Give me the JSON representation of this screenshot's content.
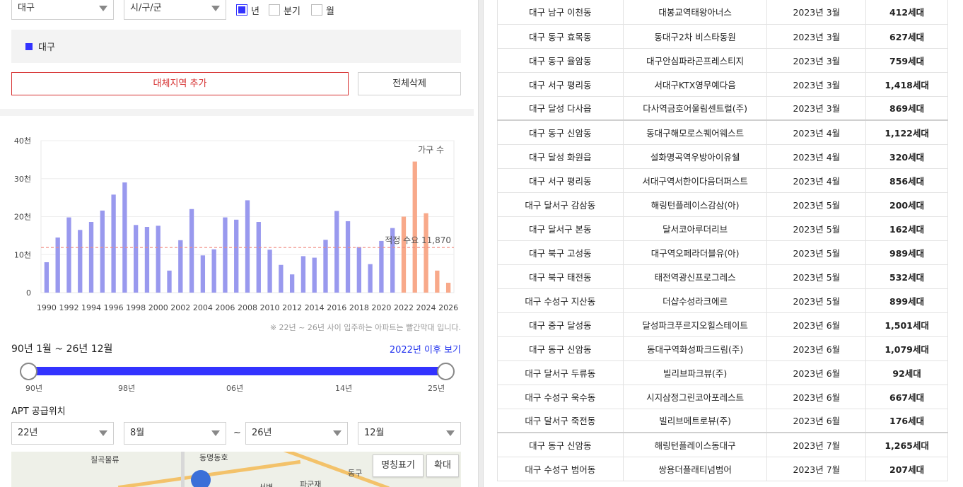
{
  "filters": {
    "region": "대구",
    "district": "시/구/군",
    "period_options": [
      {
        "label": "년",
        "checked": true
      },
      {
        "label": "분기",
        "checked": false
      },
      {
        "label": "월",
        "checked": false
      }
    ]
  },
  "legend": {
    "label": "대구",
    "color": "#3333ff"
  },
  "buttons": {
    "add_region": "대체지역 추가",
    "delete_all": "전체삭제"
  },
  "chart_data": {
    "type": "bar",
    "legend_label": "가구 수",
    "x": [
      1990,
      1991,
      1992,
      1993,
      1994,
      1995,
      1996,
      1997,
      1998,
      1999,
      2000,
      2001,
      2002,
      2003,
      2004,
      2005,
      2006,
      2007,
      2008,
      2009,
      2010,
      2011,
      2012,
      2013,
      2014,
      2015,
      2016,
      2017,
      2018,
      2019,
      2020,
      2021,
      2022,
      2023,
      2024,
      2025,
      2026
    ],
    "values": [
      8000,
      14500,
      19800,
      16500,
      18600,
      21600,
      25800,
      29000,
      17800,
      17300,
      17600,
      5800,
      13800,
      22000,
      9800,
      11400,
      19800,
      19200,
      24300,
      18600,
      11300,
      7300,
      4800,
      9600,
      9200,
      13900,
      21500,
      18800,
      12000,
      7500,
      13600,
      17000,
      20000,
      34500,
      20900,
      5800,
      2600
    ],
    "projected_from": 2022,
    "colors": {
      "actual": "#9999ee",
      "projected": "#f8a98a"
    },
    "y_ticks": [
      "0",
      "10천",
      "20천",
      "30천",
      "40천"
    ],
    "x_ticks": [
      "1990",
      "1992",
      "1994",
      "1996",
      "1998",
      "2000",
      "2002",
      "2004",
      "2006",
      "2008",
      "2010",
      "2012",
      "2014",
      "2016",
      "2018",
      "2020",
      "2022",
      "2024",
      "2026"
    ],
    "ylim": [
      0,
      40000
    ],
    "reference_line": {
      "value": 11870,
      "label": "적정 수요 11,870",
      "color": "#f08a80"
    }
  },
  "chart_note": "※ 22년 ~ 26년 사이 입주하는 아파트는 빨간막대 입니다.",
  "range": {
    "text": "90년 1월 ~ 26년 12월",
    "link": "2022년 이후 보기",
    "ticks": [
      "90년",
      "98년",
      "06년",
      "14년",
      "25년"
    ]
  },
  "apt": {
    "title": "APT 공급위치",
    "from_year": "22년",
    "from_month": "8월",
    "tilde": "~",
    "to_year": "26년",
    "to_month": "12월"
  },
  "map": {
    "labels": [
      "칠곡물류",
      "동명동호",
      "동구",
      "파군재",
      "서변"
    ],
    "buttons": {
      "names": "명칭표기",
      "zoom": "확대"
    }
  },
  "table": {
    "rows": [
      {
        "region": "대구 남구 이천동",
        "name": "대봉교역태왕아너스",
        "date": "2023년 3월",
        "units": "412세대"
      },
      {
        "region": "대구 동구 효목동",
        "name": "동대구2차 비스타동원",
        "date": "2023년 3월",
        "units": "627세대"
      },
      {
        "region": "대구 동구 율암동",
        "name": "대구안심파라곤프레스티지",
        "date": "2023년 3월",
        "units": "759세대"
      },
      {
        "region": "대구 서구 평리동",
        "name": "서대구KTX영무예다음",
        "date": "2023년 3월",
        "units": "1,418세대"
      },
      {
        "region": "대구 달성 다사읍",
        "name": "다사역금호어울림센트럴(주)",
        "date": "2023년 3월",
        "units": "869세대"
      },
      {
        "region": "대구 동구 신암동",
        "name": "동대구해모로스퀘어웨스트",
        "date": "2023년 4월",
        "units": "1,122세대"
      },
      {
        "region": "대구 달성 화원읍",
        "name": "설화명곡역우방아이유쉘",
        "date": "2023년 4월",
        "units": "320세대"
      },
      {
        "region": "대구 서구 평리동",
        "name": "서대구역서한이다음더퍼스트",
        "date": "2023년 4월",
        "units": "856세대"
      },
      {
        "region": "대구 달서구 감삼동",
        "name": "해링턴플레이스감삼(아)",
        "date": "2023년 5월",
        "units": "200세대"
      },
      {
        "region": "대구 달서구 본동",
        "name": "달서코아루더리브",
        "date": "2023년 5월",
        "units": "162세대"
      },
      {
        "region": "대구 북구 고성동",
        "name": "대구역오페라더블유(아)",
        "date": "2023년 5월",
        "units": "989세대"
      },
      {
        "region": "대구 북구 태전동",
        "name": "태전역광신프로그레스",
        "date": "2023년 5월",
        "units": "532세대"
      },
      {
        "region": "대구 수성구 지산동",
        "name": "더샵수성라크에르",
        "date": "2023년 5월",
        "units": "899세대"
      },
      {
        "region": "대구 중구 달성동",
        "name": "달성파크푸르지오힐스테이트",
        "date": "2023년 6월",
        "units": "1,501세대"
      },
      {
        "region": "대구 동구 신암동",
        "name": "동대구역화성파크드림(주)",
        "date": "2023년 6월",
        "units": "1,079세대"
      },
      {
        "region": "대구 달서구 두류동",
        "name": "빌리브파크뷰(주)",
        "date": "2023년 6월",
        "units": "92세대"
      },
      {
        "region": "대구 수성구 욱수동",
        "name": "시지삼정그린코아포레스트",
        "date": "2023년 6월",
        "units": "667세대"
      },
      {
        "region": "대구 달서구 죽전동",
        "name": "빌리브메트로뷰(주)",
        "date": "2023년 6월",
        "units": "176세대"
      },
      {
        "region": "대구 동구 신암동",
        "name": "해링턴플레이스동대구",
        "date": "2023년 7월",
        "units": "1,265세대"
      },
      {
        "region": "대구 수성구 범어동",
        "name": "쌍용더플래티넘범어",
        "date": "2023년 7월",
        "units": "207세대"
      }
    ]
  }
}
